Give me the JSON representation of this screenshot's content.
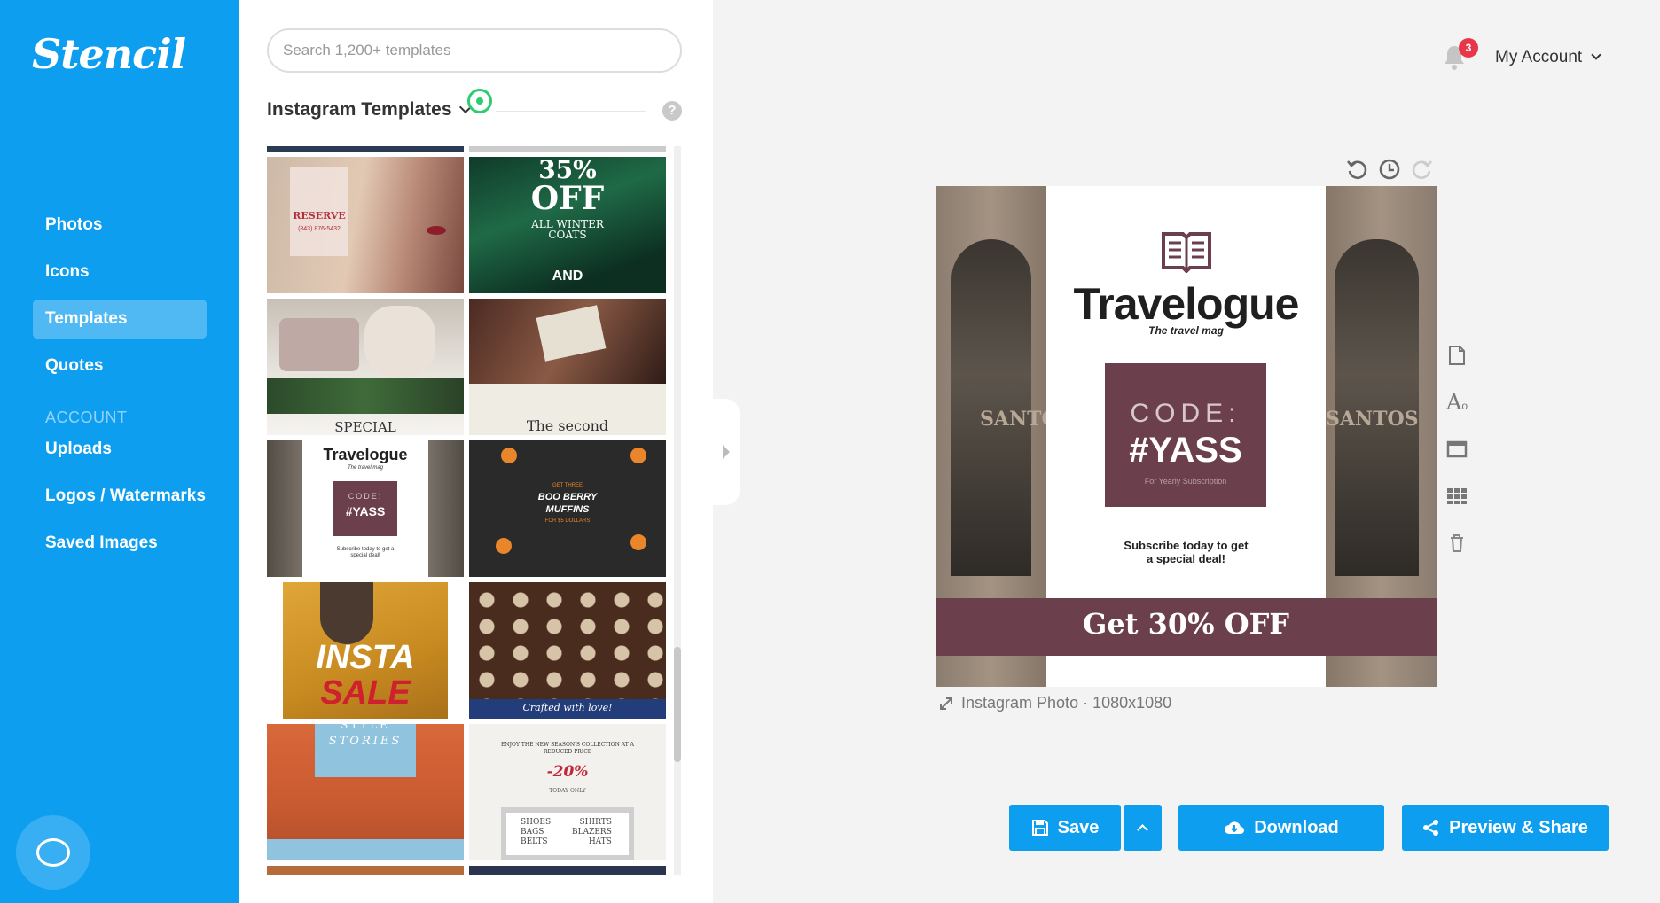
{
  "app": {
    "logo": "Stencil"
  },
  "sidebar": {
    "items": [
      {
        "label": "Photos"
      },
      {
        "label": "Icons"
      },
      {
        "label": "Templates",
        "active": true
      },
      {
        "label": "Quotes"
      }
    ],
    "account_section": "ACCOUNT",
    "account_items": [
      {
        "label": "Uploads"
      },
      {
        "label": "Logos / Watermarks"
      },
      {
        "label": "Saved Images"
      }
    ]
  },
  "panel": {
    "search_placeholder": "Search 1,200+ templates",
    "title": "Instagram Templates",
    "help": "?",
    "thumbs": {
      "reserve": "RESERVE",
      "reserve_phone": "(843) 876-5432",
      "off_pct": "35%",
      "off": "OFF",
      "off_sub": "ALL WINTER COATS",
      "off_brand": "AND",
      "special": "SPECIAL",
      "second": "The second",
      "travelogue": "Travelogue",
      "travel_sub": "The travel mag",
      "code": "CODE:",
      "yass": "#YASS",
      "subscribe_small": "Subscribe today to get a special deal!",
      "muffin_line1": "GET THREE",
      "muffin_line2": "BOO BERRY",
      "muffin_line3": "MUFFINS",
      "muffin_line4": "FOR $5 DOLLARS",
      "insta": "INSTA",
      "sale": "SALE",
      "crafted": "Crafted with love!",
      "stories": "STORIES",
      "style": "STYLE",
      "season": "ENJOY THE NEW SEASON'S COLLECTION AT A REDUCED PRICE",
      "discount": "-20%",
      "today": "TODAY ONLY",
      "shoes": "SHOES",
      "bags": "BAGS",
      "belts": "BELTS",
      "shirts": "SHIRTS",
      "blazers": "BLAZERS",
      "hats": "HATS"
    }
  },
  "header": {
    "notifications": "3",
    "account": "My Account"
  },
  "canvas": {
    "brand": "Travelogue",
    "tagline": "The travel mag",
    "code_label": "CODE:",
    "code_value": "#YASS",
    "code_sub": "For Yearly Subscription",
    "subscribe": "Subscribe today to get a special deal!",
    "banner": "Get 30% OFF",
    "shop_sign_left": "SANTO",
    "shop_sign_right": "SANTOS",
    "caption": "Instagram Photo · 1080x1080",
    "colors": {
      "accent": "#6b3f4c",
      "brand_blue": "#0d9ef0"
    }
  },
  "actions": {
    "save": "Save",
    "download": "Download",
    "preview": "Preview & Share"
  }
}
